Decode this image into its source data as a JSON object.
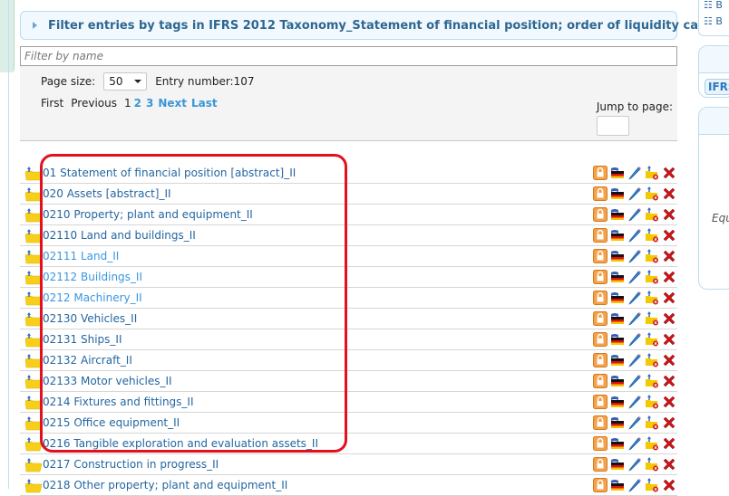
{
  "filter_panel": {
    "title": "Filter entries by tags in IFRS 2012 Taxonomy_Statement of financial position; order of liquidity category",
    "name_filter_placeholder": "Filter by name"
  },
  "pager": {
    "page_size_label": "Page size:",
    "page_size_value": "50",
    "entry_number_label": "Entry number:107",
    "first": "First",
    "previous": "Previous",
    "current_page": "1",
    "pages": [
      "2",
      "3"
    ],
    "next": "Next",
    "last": "Last",
    "jump_label": "Jump to page:",
    "jump_value": ""
  },
  "entries": [
    {
      "name": "01 Statement of financial position [abstract]_II",
      "visited": true
    },
    {
      "name": "020 Assets [abstract]_II",
      "visited": true
    },
    {
      "name": "0210 Property; plant and equipment_II",
      "visited": true
    },
    {
      "name": "02110 Land and buildings_II",
      "visited": true
    },
    {
      "name": "02111 Land_II",
      "visited": false
    },
    {
      "name": "02112 Buildings_II",
      "visited": false
    },
    {
      "name": "0212 Machinery_II",
      "visited": false
    },
    {
      "name": "02130 Vehicles_II",
      "visited": true
    },
    {
      "name": "02131 Ships_II",
      "visited": true
    },
    {
      "name": "02132 Aircraft_II",
      "visited": true
    },
    {
      "name": "02133 Motor vehicles_II",
      "visited": true
    },
    {
      "name": "0214 Fixtures and fittings_II",
      "visited": true
    },
    {
      "name": "0215 Office equipment_II",
      "visited": true
    },
    {
      "name": "0216 Tangible exploration and evaluation assets_II",
      "visited": true
    },
    {
      "name": "0217 Construction in progress_II",
      "visited": true
    },
    {
      "name": "0218 Other property; plant and equipment_II",
      "visited": true
    }
  ],
  "entry_actions": [
    "lock-icon",
    "translate-flag-icon",
    "edit-pencil-icon",
    "remove-from-folder-icon",
    "delete-icon"
  ],
  "right_sidebar": {
    "items": [
      "B",
      "B"
    ],
    "tag": "IFRS",
    "italic_text": "Equ"
  },
  "colors": {
    "highlight": "#e3101f",
    "link_visited": "#2466a0",
    "link_fresh": "#3a96e0",
    "header_text": "#2d6791"
  }
}
